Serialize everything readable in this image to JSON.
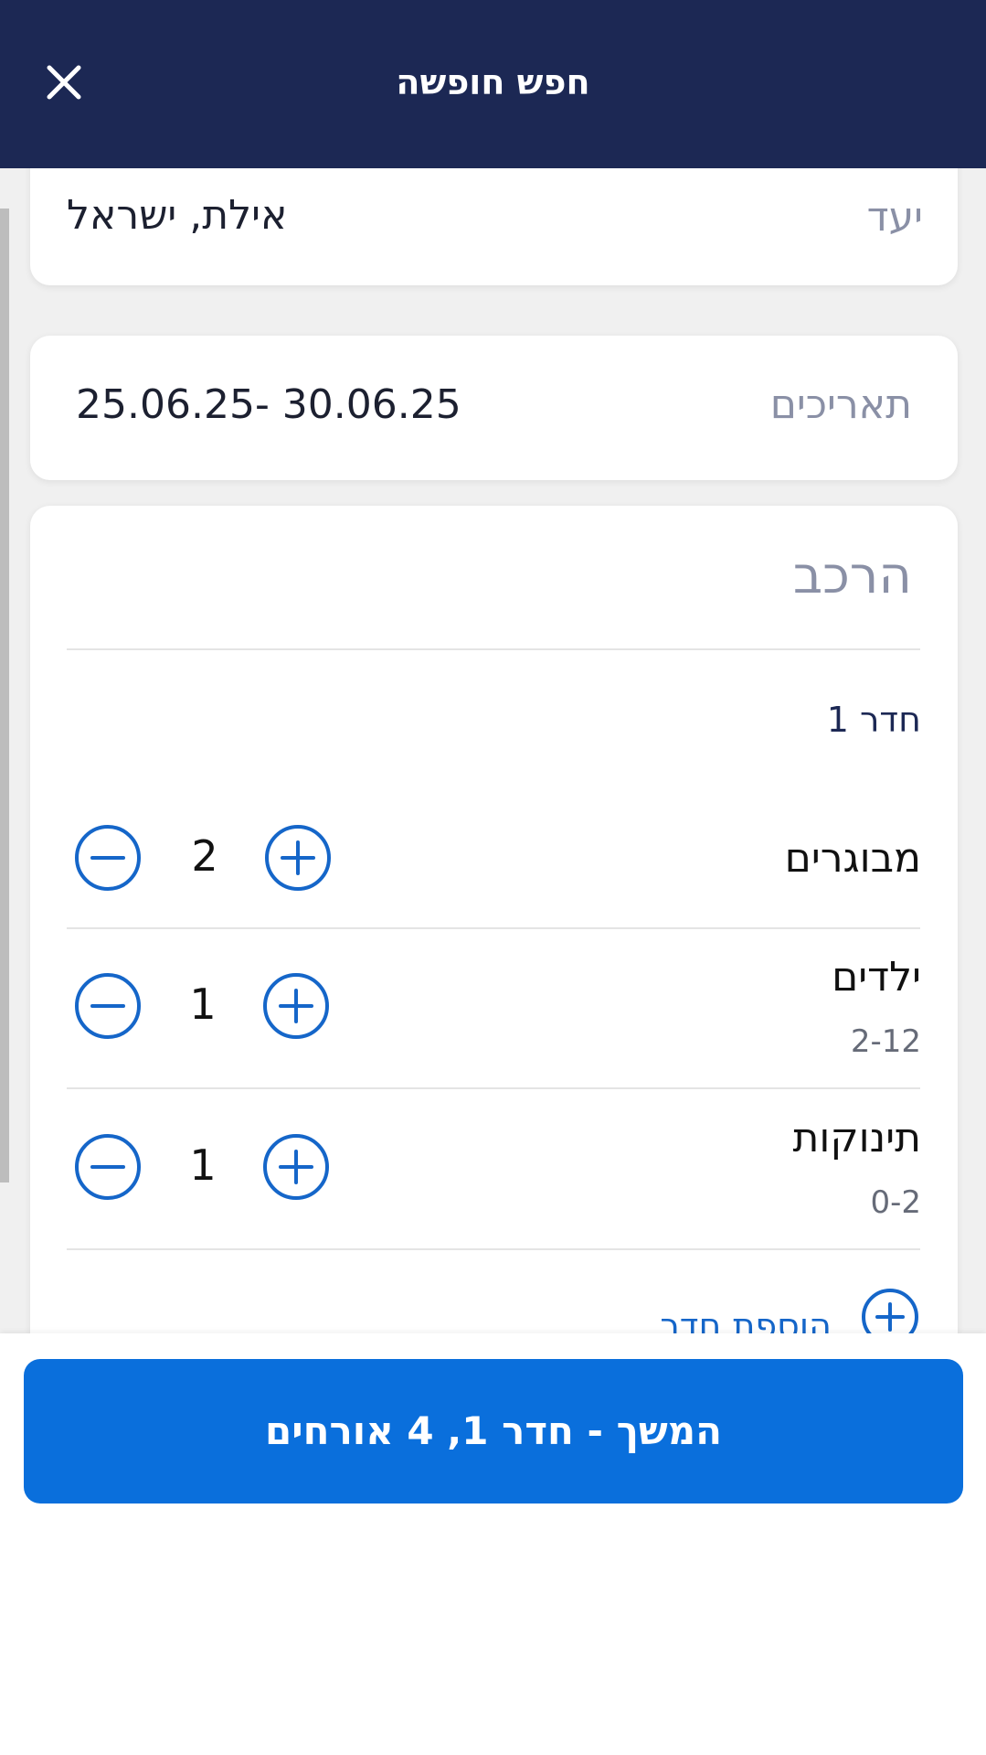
{
  "header": {
    "title": "חפש חופשה",
    "close_icon": "close-icon"
  },
  "destination": {
    "label": "יעד",
    "value": "אילת, ישראל"
  },
  "dates": {
    "label": "תאריכים",
    "value": "25.06.25- 30.06.25"
  },
  "composition": {
    "title": "הרכב",
    "room_title": "חדר 1",
    "rows": [
      {
        "label": "מבוגרים",
        "sub": "",
        "value": "2"
      },
      {
        "label": "ילדים",
        "sub": "2-12",
        "value": "1"
      },
      {
        "label": "תינוקות",
        "sub": "0-2",
        "value": "1"
      }
    ],
    "add_room_label": "הוספת חדר"
  },
  "footer": {
    "continue_label": "המשך - חדר 1, 4 אורחים"
  },
  "colors": {
    "header_bg": "#1c2854",
    "accent": "#0a6fdc",
    "stepper": "#1566c9"
  }
}
